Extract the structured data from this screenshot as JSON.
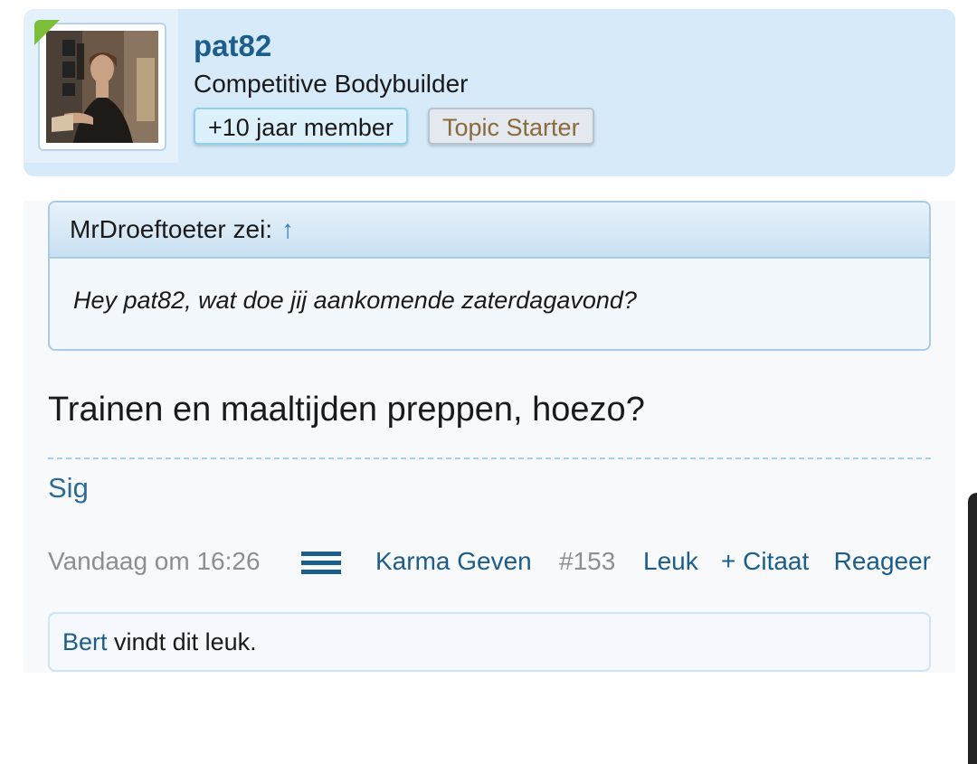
{
  "user": {
    "username": "pat82",
    "title": "Competitive Bodybuilder",
    "badges": [
      {
        "label": "+10 jaar member"
      },
      {
        "label": "Topic Starter"
      }
    ],
    "online": true
  },
  "post": {
    "quote": {
      "author_line": "MrDroeftoeter zei:",
      "arrow": "↑",
      "text": "Hey pat82, wat doe jij aankomende zaterdagavond?"
    },
    "message": "Trainen en maaltijden preppen, hoezo?",
    "sig_label": "Sig",
    "actions": {
      "timestamp": "Vandaag om 16:26",
      "karma": "Karma Geven",
      "post_number": "#153",
      "like": "Leuk",
      "quote": "+ Citaat",
      "reply": "Reageer"
    },
    "likes": {
      "liker": "Bert",
      "suffix": " vindt dit leuk."
    }
  },
  "icons": {
    "menu": "hamburger-menu-icon",
    "quote_arrow": "up-arrow-icon"
  },
  "colors": {
    "accent": "#1c5d8c",
    "header_bg": "#d6eaf9",
    "online": "#7cbd3a"
  }
}
